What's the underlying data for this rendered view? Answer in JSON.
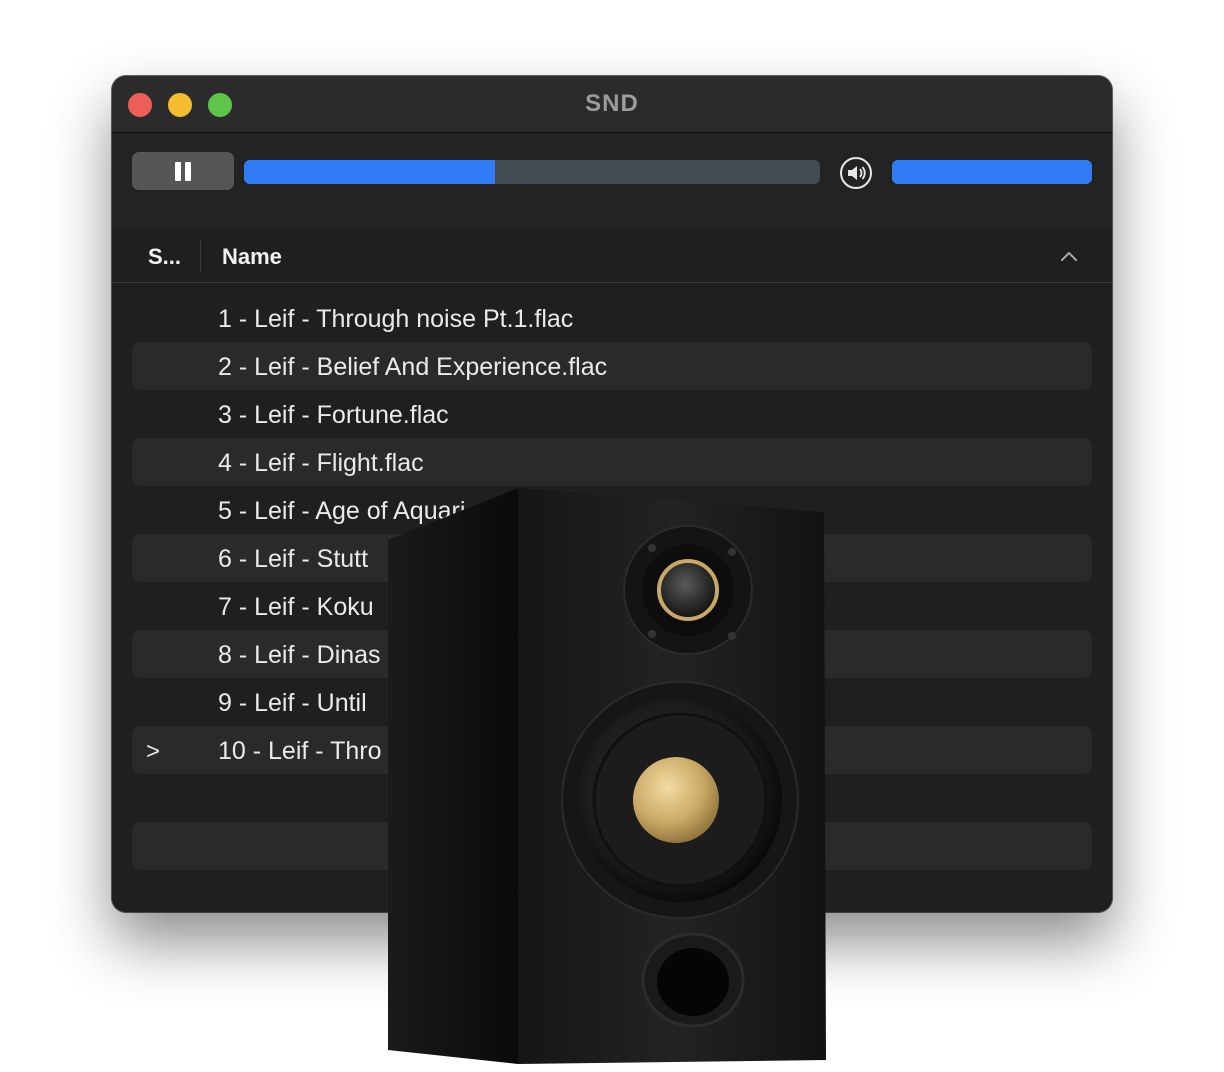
{
  "window": {
    "title": "SND",
    "traffic_lights": {
      "close": "#ec5f57",
      "minimize": "#f4bd2f",
      "maximize": "#5fc54a"
    }
  },
  "toolbar": {
    "play_pause_icon": "pause-icon",
    "progress_fraction": 0.435,
    "volume_icon": "speaker-volume-icon",
    "volume_fraction": 1.0,
    "accent_color": "#2f7cf6"
  },
  "table": {
    "columns": {
      "status": "S...",
      "name": "Name"
    },
    "sort_icon": "chevron-up-icon",
    "rows": [
      {
        "marker": "",
        "name": "1 - Leif - Through noise Pt.1.flac"
      },
      {
        "marker": "",
        "name": "2 - Leif - Belief And Experience.flac"
      },
      {
        "marker": "",
        "name": "3 - Leif - Fortune.flac"
      },
      {
        "marker": "",
        "name": "4 - Leif - Flight.flac"
      },
      {
        "marker": "",
        "name": "5 - Leif - Age of Aquari"
      },
      {
        "marker": "",
        "name": "6 - Leif - Stutt"
      },
      {
        "marker": "",
        "name": "7 - Leif - Koku"
      },
      {
        "marker": "",
        "name": "8 - Leif - Dinas"
      },
      {
        "marker": "",
        "name": "9 - Leif - Until"
      },
      {
        "marker": ">",
        "name": "10 - Leif - Thro"
      },
      {
        "marker": "",
        "name": ""
      },
      {
        "marker": "",
        "name": ""
      }
    ]
  },
  "overlay": {
    "image": "bookshelf-speaker-image"
  }
}
